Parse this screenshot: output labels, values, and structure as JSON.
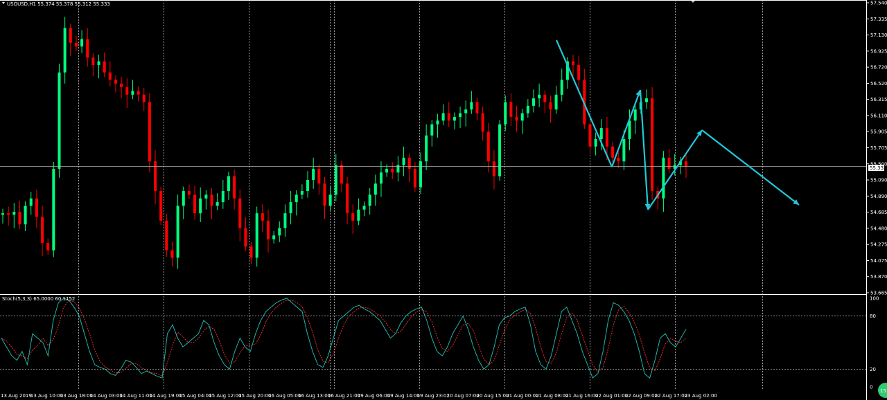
{
  "header": {
    "symbol_caption": "USOUSD,H1 55.374 55.378 55.312 55.333",
    "dropdown_icon": "triangle-down-icon"
  },
  "indicator": {
    "caption": "Stoch(5,3,3) 65.0000 60.1152",
    "levels_labels": [
      "100",
      "80",
      "20",
      "0"
    ]
  },
  "current_price_label": "55.333",
  "badge_text": "15",
  "colors": {
    "background": "#000000",
    "bull": "#00ff7f",
    "bear": "#ff0000",
    "grid": "#ffffff",
    "stoch_main": "#20b2aa",
    "stoch_signal": "#ff3030",
    "arrow": "#22c7d8",
    "badge": "#2ecc71"
  },
  "chart_data": {
    "type": "candlestick",
    "symbol": "USOUSD",
    "timeframe": "H1",
    "ylim": [
      53.665,
      57.54
    ],
    "y_ticks": [
      "57.540",
      "57.335",
      "57.130",
      "56.925",
      "56.720",
      "56.520",
      "56.315",
      "56.110",
      "55.905",
      "55.705",
      "55.500",
      "55.090",
      "54.890",
      "54.685",
      "54.480",
      "54.275",
      "54.075",
      "53.870",
      "53.665"
    ],
    "x_ticks": [
      "13 Aug 2019",
      "13 Aug 10:00",
      "13 Aug 18:00",
      "14 Aug 03:00",
      "14 Aug 11:00",
      "14 Aug 19:00",
      "15 Aug 04:00",
      "15 Aug 12:00",
      "15 Aug 20:00",
      "16 Aug 05:00",
      "16 Aug 13:00",
      "16 Aug 21:00",
      "19 Aug 06:00",
      "19 Aug 14:00",
      "19 Aug 23:01",
      "20 Aug 07:00",
      "20 Aug 15:00",
      "21 Aug 00:00",
      "21 Aug 08:00",
      "21 Aug 16:00",
      "22 Aug 01:00",
      "22 Aug 09:00",
      "22 Aug 17:00",
      "23 Aug 02:00"
    ],
    "current_price": 55.333,
    "price_path": [
      54.7,
      54.68,
      54.72,
      54.55,
      54.8,
      54.9,
      54.65,
      54.3,
      54.2,
      55.3,
      56.6,
      57.2,
      57.0,
      56.95,
      57.05,
      56.8,
      56.7,
      56.75,
      56.6,
      56.5,
      56.45,
      56.4,
      56.3,
      56.35,
      56.3,
      56.2,
      55.4,
      55.0,
      54.6,
      54.2,
      54.1,
      54.8,
      55.0,
      54.95,
      54.7,
      54.9,
      54.95,
      54.8,
      54.85,
      55.0,
      55.2,
      54.9,
      54.5,
      54.25,
      54.1,
      54.7,
      54.6,
      54.35,
      54.4,
      54.5,
      54.7,
      54.85,
      54.95,
      55.0,
      55.15,
      55.3,
      55.1,
      54.8,
      54.95,
      55.35,
      55.1,
      54.7,
      54.6,
      54.75,
      54.8,
      54.95,
      55.1,
      55.25,
      55.3,
      55.25,
      55.35,
      55.45,
      55.3,
      55.05,
      55.4,
      55.75,
      55.9,
      55.95,
      56.05,
      55.95,
      56.0,
      56.05,
      56.1,
      56.2,
      56.05,
      55.8,
      55.4,
      55.2,
      55.9,
      56.2,
      56.0,
      55.95,
      56.05,
      56.15,
      56.25,
      56.3,
      56.2,
      56.1,
      56.3,
      56.5,
      56.75,
      56.7,
      56.5,
      55.9,
      55.6,
      55.7,
      55.85,
      55.6,
      55.45,
      55.4,
      55.7,
      55.95,
      56.1,
      56.2,
      56.25,
      55.0,
      54.9,
      55.45,
      55.3,
      55.35,
      55.4,
      55.33
    ],
    "drawn_lines": [
      {
        "type": "zigzag",
        "points": [
          [
            56.97,
            "21 Aug 08:00"
          ],
          [
            55.38,
            "22 Aug 01:00"
          ],
          [
            56.27,
            "22 Aug 09:00"
          ],
          [
            54.78,
            "22 Aug 13:00"
          ],
          [
            55.85,
            "22 Aug 23:00"
          ],
          [
            54.85,
            "projection"
          ]
        ]
      }
    ],
    "stochastic": {
      "params": "5,3,3",
      "main": 65.0,
      "signal": 60.1152,
      "levels": [
        80,
        20
      ],
      "ylim": [
        0,
        100
      ],
      "main_path": [
        55,
        45,
        35,
        30,
        40,
        25,
        60,
        55,
        50,
        35,
        75,
        95,
        100,
        98,
        90,
        80,
        60,
        40,
        25,
        22,
        20,
        15,
        13,
        20,
        30,
        28,
        22,
        15,
        18,
        15,
        12,
        10,
        60,
        70,
        55,
        45,
        50,
        55,
        60,
        75,
        70,
        50,
        35,
        25,
        20,
        40,
        55,
        45,
        40,
        60,
        75,
        85,
        90,
        95,
        98,
        100,
        95,
        90,
        85,
        60,
        40,
        25,
        22,
        35,
        55,
        75,
        80,
        85,
        90,
        92,
        88,
        85,
        80,
        75,
        65,
        55,
        60,
        72,
        80,
        85,
        88,
        90,
        75,
        55,
        40,
        35,
        45,
        60,
        70,
        80,
        65,
        45,
        30,
        20,
        25,
        45,
        70,
        78,
        80,
        85,
        88,
        90,
        70,
        40,
        25,
        20,
        35,
        60,
        85,
        90,
        75,
        60,
        40,
        25,
        10,
        15,
        40,
        75,
        95,
        92,
        85,
        75,
        60,
        40,
        15,
        10,
        30,
        55,
        60,
        50,
        45,
        55,
        65
      ]
    }
  }
}
